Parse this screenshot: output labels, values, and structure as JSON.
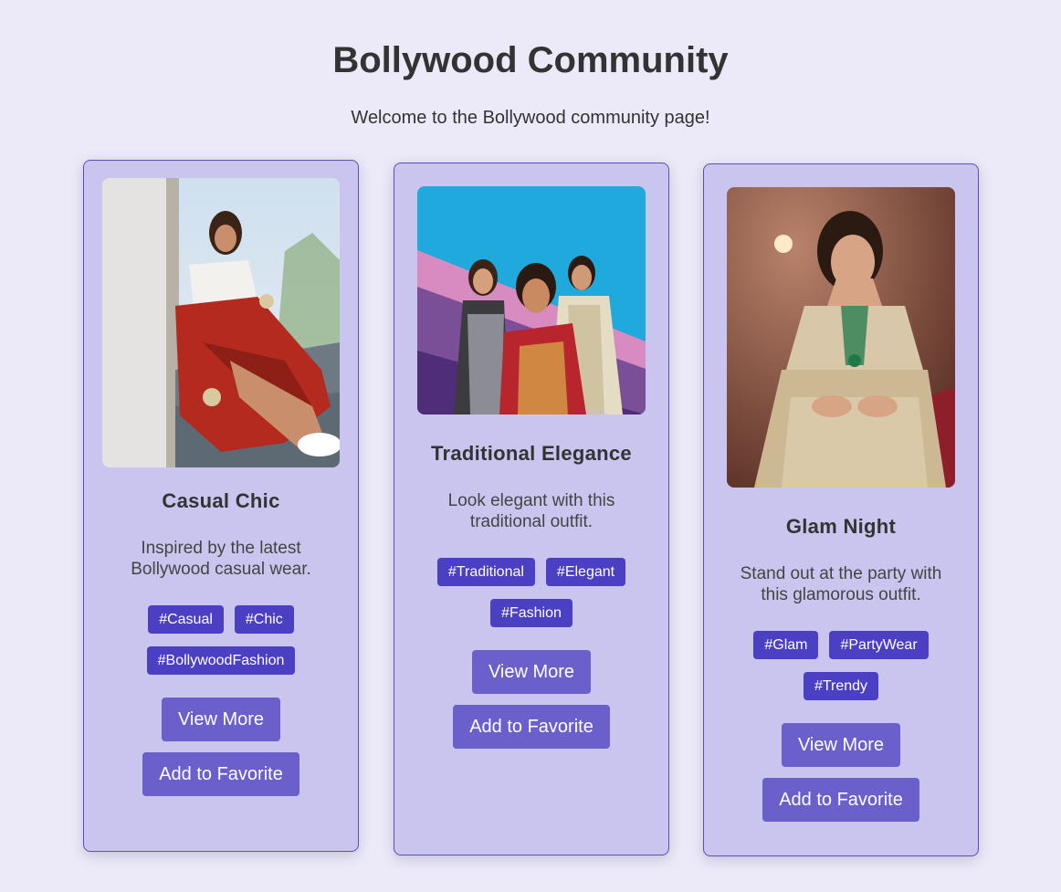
{
  "header": {
    "title": "Bollywood Community",
    "subtitle": "Welcome to the Bollywood community page!"
  },
  "cards": [
    {
      "title": "Casual Chic",
      "description": "Inspired by the latest Bollywood casual wear.",
      "tags": [
        "#Casual",
        "#Chic",
        "#BollywoodFashion"
      ],
      "view_more_label": "View More",
      "favorite_label": "Add to Favorite"
    },
    {
      "title": "Traditional Elegance",
      "description": "Look elegant with this traditional outfit.",
      "tags": [
        "#Traditional",
        "#Elegant",
        "#Fashion"
      ],
      "view_more_label": "View More",
      "favorite_label": "Add to Favorite"
    },
    {
      "title": "Glam Night",
      "description": "Stand out at the party with this glamorous outfit.",
      "tags": [
        "#Glam",
        "#PartyWear",
        "#Trendy"
      ],
      "view_more_label": "View More",
      "favorite_label": "Add to Favorite"
    }
  ],
  "colors": {
    "background": "#eceaf8",
    "card": "#c9c5ee",
    "tag": "#4b3fc4",
    "button": "#6a5fcb"
  }
}
